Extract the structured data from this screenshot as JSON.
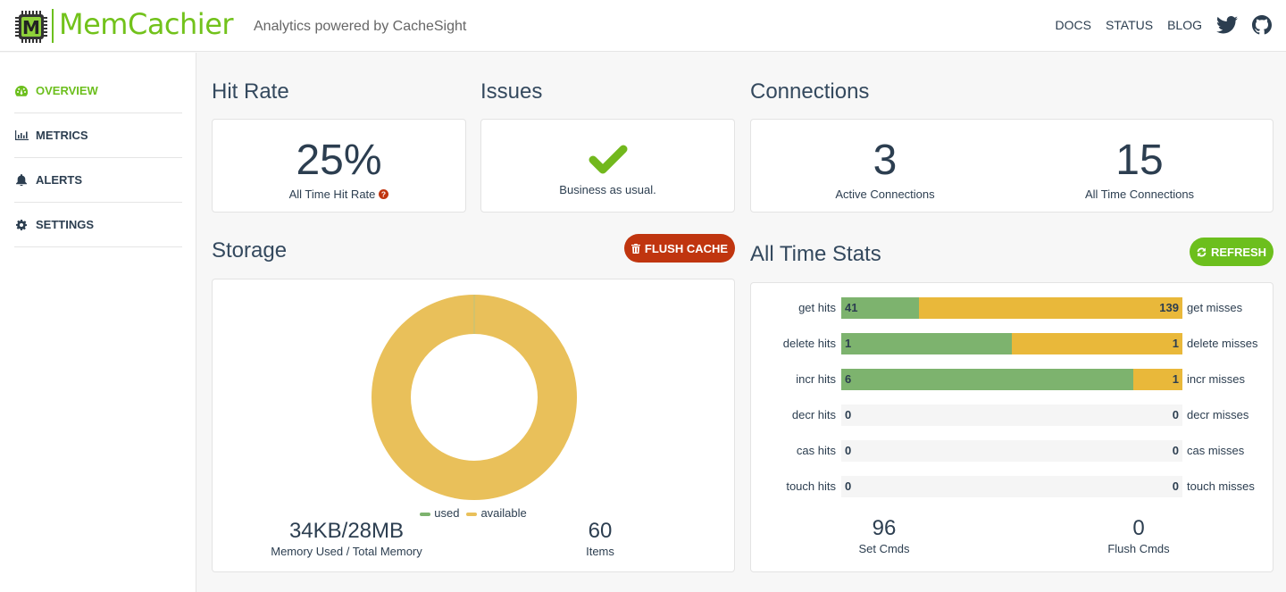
{
  "header": {
    "brand": "MemCachier",
    "tagline": "Analytics powered by CacheSight",
    "nav": [
      {
        "label": "DOCS"
      },
      {
        "label": "STATUS"
      },
      {
        "label": "BLOG"
      }
    ],
    "icons": [
      "twitter-icon",
      "github-icon"
    ]
  },
  "sidebar": {
    "items": [
      {
        "label": "OVERVIEW",
        "icon": "dashboard-icon",
        "active": true
      },
      {
        "label": "METRICS",
        "icon": "bar-chart-icon",
        "active": false
      },
      {
        "label": "ALERTS",
        "icon": "bell-icon",
        "active": false
      },
      {
        "label": "SETTINGS",
        "icon": "gear-icon",
        "active": false
      }
    ]
  },
  "hit_rate": {
    "title": "Hit Rate",
    "value": "25%",
    "label": "All Time Hit Rate"
  },
  "issues": {
    "title": "Issues",
    "status": "Business as usual."
  },
  "connections": {
    "title": "Connections",
    "active_value": "3",
    "active_label": "Active Connections",
    "all_time_value": "15",
    "all_time_label": "All Time Connections"
  },
  "storage": {
    "title": "Storage",
    "flush_label": "FLUSH CACHE",
    "legend": [
      {
        "label": "used",
        "color": "#7db36e"
      },
      {
        "label": "available",
        "color": "#e9c05a"
      }
    ],
    "memory_value": "34KB/28MB",
    "memory_label": "Memory Used / Total Memory",
    "items_value": "60",
    "items_label": "Items"
  },
  "all_time_stats": {
    "title": "All Time Stats",
    "refresh_label": "REFRESH",
    "rows": [
      {
        "hit_label": "get hits",
        "hits": 41,
        "misses": 139,
        "miss_label": "get misses"
      },
      {
        "hit_label": "delete hits",
        "hits": 1,
        "misses": 1,
        "miss_label": "delete misses"
      },
      {
        "hit_label": "incr hits",
        "hits": 6,
        "misses": 1,
        "miss_label": "incr misses"
      },
      {
        "hit_label": "decr hits",
        "hits": 0,
        "misses": 0,
        "miss_label": "decr misses"
      },
      {
        "hit_label": "cas hits",
        "hits": 0,
        "misses": 0,
        "miss_label": "cas misses"
      },
      {
        "hit_label": "touch hits",
        "hits": 0,
        "misses": 0,
        "miss_label": "touch misses"
      }
    ],
    "set_cmds_value": "96",
    "set_cmds_label": "Set Cmds",
    "flush_cmds_value": "0",
    "flush_cmds_label": "Flush Cmds"
  },
  "colors": {
    "brand_green": "#72c21b",
    "hit": "#7db36e",
    "miss": "#e9b83a",
    "danger": "#c0350f"
  }
}
